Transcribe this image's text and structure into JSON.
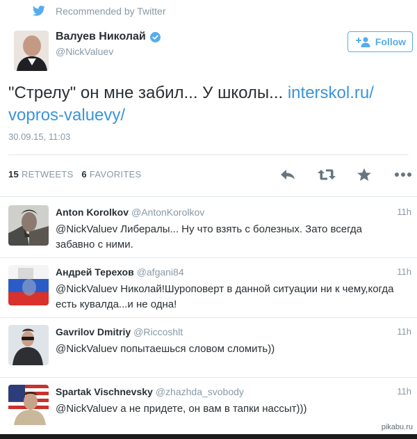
{
  "recommended": "Recommended by Twitter",
  "author": {
    "name": "Валуев Николай",
    "handle": "@NickValuev"
  },
  "follow_label": "Follow",
  "tweet": {
    "text": "\"Стрелу\" он мне забил... У школы...",
    "link_line1": "interskol.ru/",
    "link_line2": "vopros-valuevy/",
    "timestamp": "30.09.15, 11:03"
  },
  "stats": {
    "retweets_count": "15",
    "retweets_label": "RETWEETS",
    "favorites_count": "6",
    "favorites_label": "FAVORITES"
  },
  "replies": [
    {
      "name": "Anton Korolkov",
      "handle": "@AntonKorolkov",
      "time": "11h",
      "text": "@NickValuev Либералы... Ну что взять с болезных. Зато всегда забавно с ними."
    },
    {
      "name": "Андрей Терехов",
      "handle": "@afgani84",
      "time": "11h",
      "text": "@NickValuev Николай!Шуроповерт в данной ситуации ни к чему,когда есть кувалда...и не одна!"
    },
    {
      "name": "Gavrilov Dmitriy",
      "handle": "@Riccoshlt",
      "time": "11h",
      "text": "@NickValuev попытаешься словом сломить))"
    },
    {
      "name": "Spartak Vischnevsky",
      "handle": "@zhazhda_svobody",
      "time": "11h",
      "text": "@NickValuev а не придете, он вам в тапки нассыт)))"
    }
  ],
  "watermark": "pikabu.ru",
  "colors": {
    "twitter_blue": "#55acee",
    "link_blue": "#3b94d9",
    "muted": "#8899a6",
    "text": "#292f33",
    "divider": "#e1e8ed"
  },
  "icons": {
    "bird": "twitter-bird-icon",
    "verified": "verified-badge-icon",
    "follow": "add-person-icon",
    "reply": "reply-icon",
    "retweet": "retweet-icon",
    "favorite": "star-icon",
    "more": "more-dots-icon"
  }
}
